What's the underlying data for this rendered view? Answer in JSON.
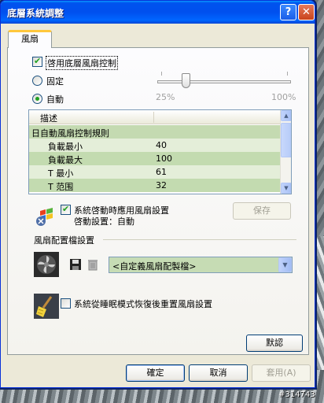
{
  "window": {
    "title": "底層系統調整"
  },
  "tabs": [
    {
      "label": "風扇"
    }
  ],
  "fan": {
    "enable_label": "啓用底層風扇控制",
    "fixed_label": "固定",
    "auto_label": "自動",
    "slider": {
      "min_label": "25%",
      "max_label": "100%",
      "value_percent": 25
    }
  },
  "table": {
    "header": "描述",
    "group": "日自動風扇控制規則",
    "rows": [
      {
        "name": "負載最小",
        "value": "40"
      },
      {
        "name": "負載最大",
        "value": "100"
      },
      {
        "name": "T 最小",
        "value": "61"
      },
      {
        "name": "T 范围",
        "value": "32"
      }
    ]
  },
  "startup": {
    "checkbox_label": "系統啓動時應用風扇設置",
    "status": "啓動設置：自動",
    "save_label": "保存"
  },
  "profile": {
    "section_label": "風扇配置檔設置",
    "combo_value": "<自定義風扇配製檔>"
  },
  "sleep": {
    "checkbox_label": "系統從睡眠模式恢復後重置風扇設置"
  },
  "buttons": {
    "default": "默認",
    "ok": "確定",
    "cancel": "取消",
    "apply": "套用(A)"
  },
  "watermark": "#314743",
  "colors": {
    "titlebar": "#0053ee",
    "accent_green": "#21a121",
    "row_green": "#c3dbb0"
  }
}
